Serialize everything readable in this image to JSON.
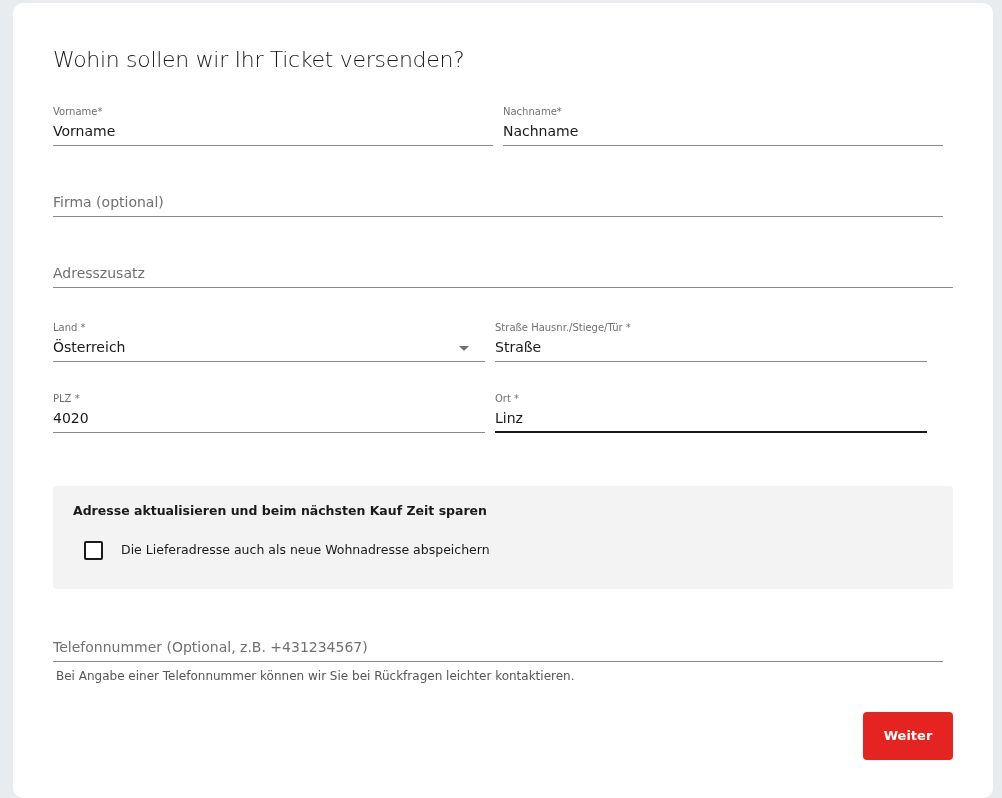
{
  "title": "Wohin sollen wir Ihr Ticket versenden?",
  "fields": [
    {
      "kind": "text",
      "label": "Vorname*",
      "value": "Vorname",
      "focused": false
    },
    {
      "kind": "text",
      "label": "Nachname*",
      "value": "Nachname",
      "focused": false
    },
    {
      "kind": "text",
      "placeholder": "Firma (optional)",
      "focused": false
    },
    {
      "kind": "text",
      "placeholder": "Adresszusatz",
      "focused": false
    },
    {
      "kind": "select",
      "label": "Land *",
      "value": "Österreich",
      "focused": false
    },
    {
      "kind": "text",
      "label": "Straße Hausnr./Stiege/Tür *",
      "value": "Straße",
      "focused": false
    },
    {
      "kind": "text",
      "label": "PLZ *",
      "value": "4020",
      "focused": false
    },
    {
      "kind": "text",
      "label": "Ort *",
      "value": "Linz",
      "focused": true
    }
  ],
  "address_box": {
    "heading": "Adresse aktualisieren und beim nächsten Kauf Zeit sparen",
    "checkbox": {
      "label": "Die Lieferadresse auch als neue Wohnadresse abspeichern",
      "checked": false
    }
  },
  "phone": {
    "placeholder": "Telefonnummer (Optional, z.B. +431234567)",
    "hint": "Bei Angabe einer Telefonnummer können wir Sie bei Rückfragen leichter kontaktieren."
  },
  "button": "Weiter"
}
